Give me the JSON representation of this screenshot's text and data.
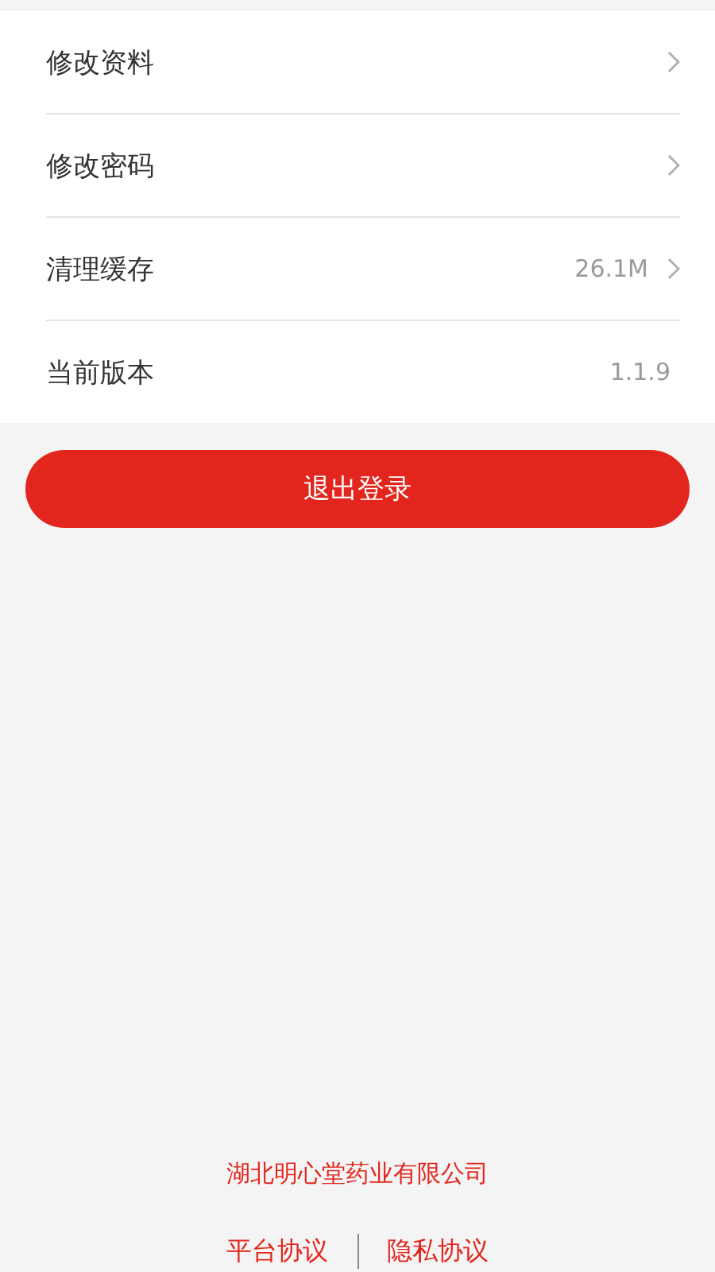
{
  "settings": [
    {
      "label": "修改资料",
      "kind": "link"
    },
    {
      "label": "修改密码",
      "kind": "link"
    },
    {
      "label": "清理缓存",
      "kind": "link",
      "value": "26.1M"
    },
    {
      "label": "当前版本",
      "kind": "info",
      "value": "1.1.9"
    }
  ],
  "logout_button": {
    "label": "退出登录"
  },
  "footer": {
    "company": "湖北明心堂药业有限公司",
    "links": [
      "平台协议",
      "隐私协议"
    ]
  }
}
